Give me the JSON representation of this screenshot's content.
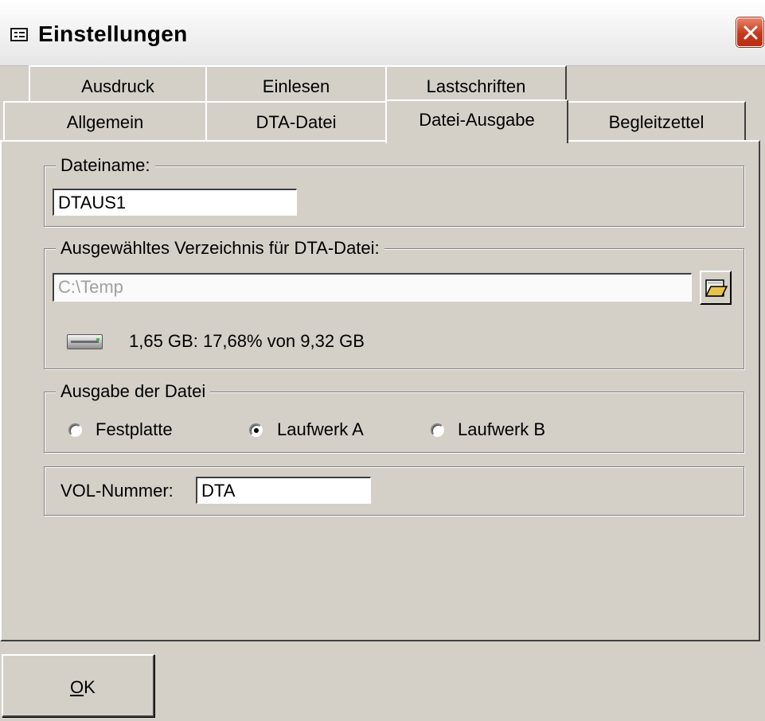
{
  "window": {
    "title": "Einstellungen",
    "title_icon": "form-icon",
    "close_icon": "close-icon"
  },
  "tabs": {
    "row1": [
      {
        "label": "Ausdruck"
      },
      {
        "label": "Einlesen"
      },
      {
        "label": "Lastschriften"
      }
    ],
    "row2": [
      {
        "label": "Allgemein"
      },
      {
        "label": "DTA-Datei"
      },
      {
        "label": "Datei-Ausgabe",
        "active": true
      },
      {
        "label": "Begleitzettel"
      }
    ]
  },
  "dateiname": {
    "group_label": "Dateiname:",
    "value": "DTAUS1"
  },
  "verzeichnis": {
    "group_label": "Ausgewähltes Verzeichnis für DTA-Datei:",
    "path": "C:\\Temp",
    "browse_icon": "folder-open-icon",
    "drive_icon": "hard-drive-icon",
    "disk_info": "1,65 GB: 17,68% von 9,32 GB"
  },
  "ausgabe": {
    "group_label": "Ausgabe der Datei",
    "options": [
      {
        "label": "Festplatte",
        "checked": false
      },
      {
        "label": "Laufwerk A",
        "checked": true
      },
      {
        "label": "Laufwerk B",
        "checked": false
      }
    ]
  },
  "vol": {
    "label": "VOL-Nummer:",
    "value": "DTA"
  },
  "ok_button": {
    "accel": "O",
    "rest": "K"
  },
  "colors": {
    "face": "#d4d0c8",
    "close_red": "#c3391c"
  }
}
